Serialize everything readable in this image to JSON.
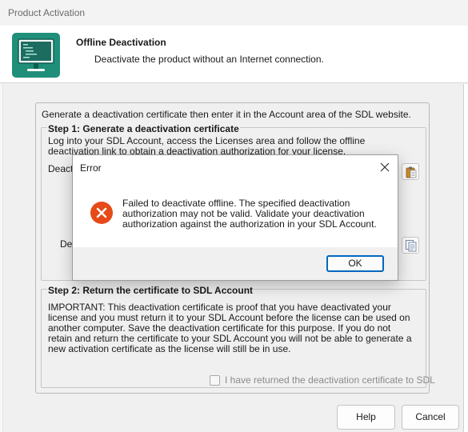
{
  "window": {
    "title": "Product Activation"
  },
  "header": {
    "title": "Offline Deactivation",
    "subtitle": "Deactivate the product without an Internet connection.",
    "logo_icon": "monitor-code-icon"
  },
  "panel": {
    "intro": "Generate a deactivation certificate then enter it in the Account area of the SDL website.",
    "step1": {
      "heading": "Step 1: Generate a deactivation certificate",
      "description": "Log into your SDL Account, access the Licenses area and follow the offline deactivation link to obtain a deactivation authorization for your license.",
      "field1_label_partial": "Deact",
      "field2_label_partial": "Dea",
      "paste_icon": "paste-icon",
      "copy_icon": "copy-icon"
    },
    "step2": {
      "heading": "Step 2: Return the certificate to SDL Account",
      "description": "IMPORTANT: This deactivation certificate is proof that you have deactivated your license and you must return it to your SDL Account before the license can be used on another computer. Save the deactivation certificate for this purpose. If you do not retain and return the certificate to your SDL Account you will not be able to generate a new activation certificate as the license will still be in use.",
      "checkbox_label": "I have returned the deactivation certificate to SDL",
      "checkbox_checked": false
    }
  },
  "buttons": {
    "help": "Help",
    "cancel": "Cancel"
  },
  "error_dialog": {
    "title": "Error",
    "message": "Failed to deactivate offline. The specified deactivation authorization may not be valid. Validate your deactivation authorization against the authorization in your SDL Account.",
    "ok": "OK",
    "icon": "error-icon",
    "accent_color": "#e64a19"
  }
}
